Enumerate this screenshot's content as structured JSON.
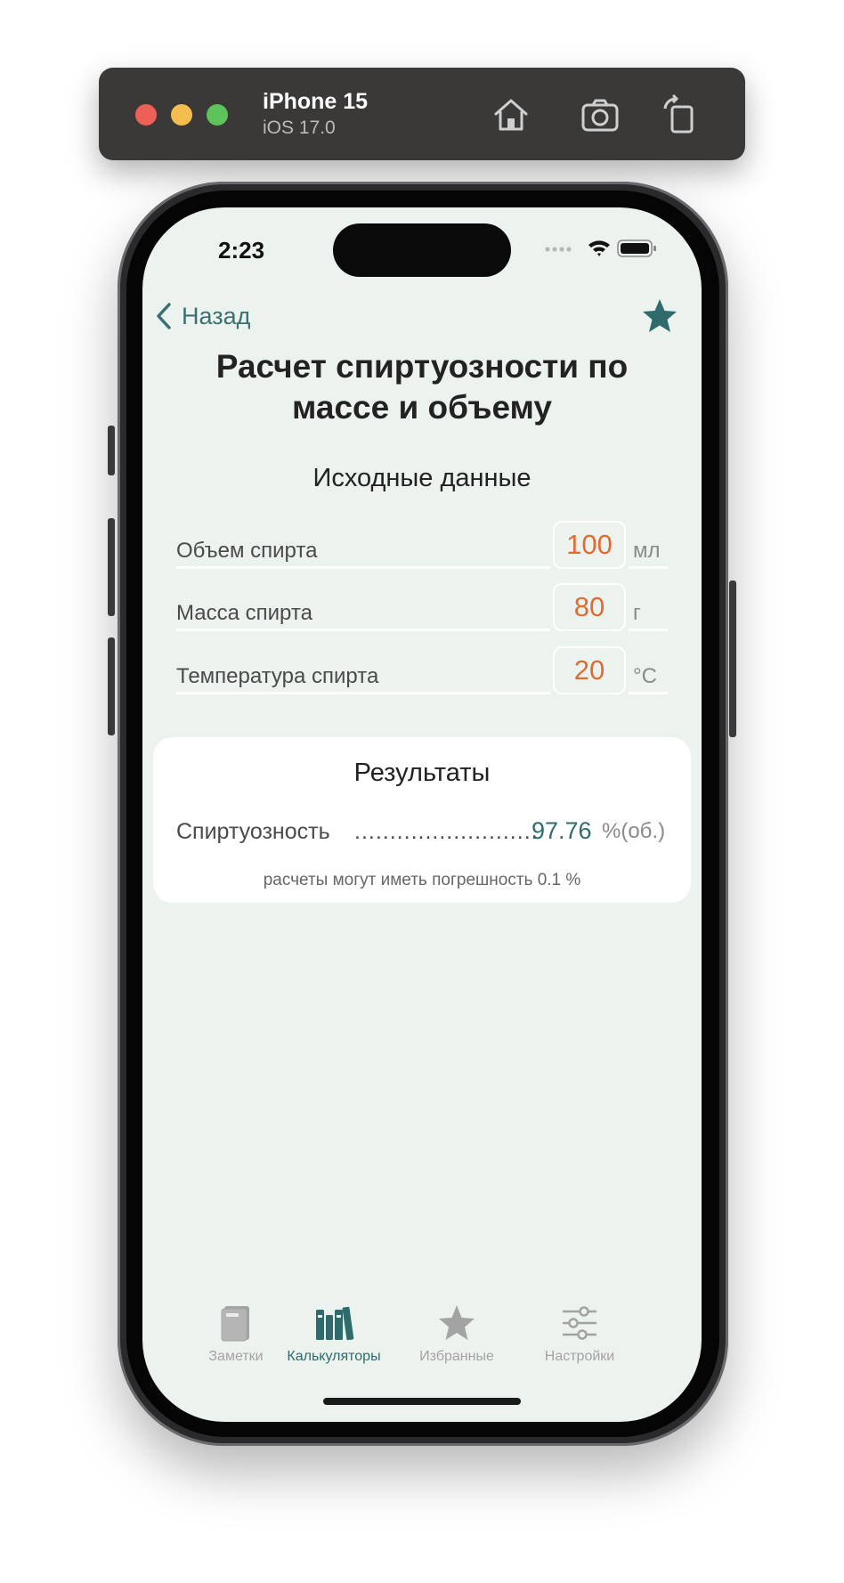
{
  "simulator": {
    "device_name": "iPhone 15",
    "os_version": "iOS 17.0"
  },
  "status_bar": {
    "time": "2:23"
  },
  "nav": {
    "back_label": "Назад"
  },
  "page": {
    "title_line1": "Расчет спиртуозности по",
    "title_line2": "массе и объему"
  },
  "inputs": {
    "heading": "Исходные данные",
    "rows": [
      {
        "label": "Объем спирта",
        "value": "100",
        "unit": "мл"
      },
      {
        "label": "Масса спирта",
        "value": "80",
        "unit": "г"
      },
      {
        "label": "Температура спирта",
        "value": "20",
        "unit": "°C"
      }
    ]
  },
  "results": {
    "heading": "Результаты",
    "label": "Спиртуозность",
    "dots": "..........................",
    "value": "97.76",
    "unit": "%(об.)",
    "note": "расчеты могут иметь погрешность 0.1 %"
  },
  "tabs": [
    {
      "label": "Заметки",
      "icon": "notebook-icon",
      "active": false
    },
    {
      "label": "Калькуляторы",
      "icon": "books-icon",
      "active": true
    },
    {
      "label": "Избранные",
      "icon": "star-icon",
      "active": false
    },
    {
      "label": "Настройки",
      "icon": "sliders-icon",
      "active": false
    }
  ],
  "colors": {
    "accent": "#2f6b6d",
    "input_value": "#e06b33",
    "screen_bg": "#ecf3ef"
  }
}
